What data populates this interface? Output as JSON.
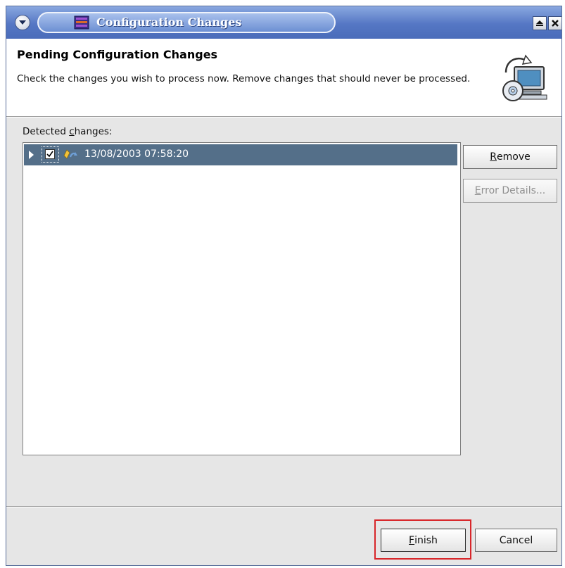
{
  "window": {
    "title": "Configuration Changes",
    "icons": {
      "menu": "chevron-down-icon",
      "app": "eclipse-app-icon",
      "maximize": "maximize-icon",
      "close": "close-icon"
    }
  },
  "header": {
    "title": "Pending Configuration Changes",
    "description": "Check the changes you wish to process now. Remove changes that should never be processed.",
    "icon": "configuration-wizard-icon"
  },
  "changes": {
    "label_prefix": "Detected ",
    "label_mnemonic": "c",
    "label_rest": "hanges:",
    "items": [
      {
        "timestamp": "13/08/2003 07:58:20",
        "checked": true,
        "selected": true,
        "icon": "configuration-change-icon"
      }
    ]
  },
  "buttons": {
    "remove": {
      "mnemonic": "R",
      "rest": "emove",
      "enabled": true
    },
    "error_details": {
      "mnemonic": "E",
      "rest": "rror Details...",
      "enabled": false
    },
    "finish": {
      "mnemonic": "F",
      "rest": "inish",
      "enabled": true
    },
    "cancel": {
      "label": "Cancel",
      "enabled": true
    }
  },
  "colors": {
    "titlebar": "#5577c4",
    "selection": "#546f89",
    "focus_highlight": "#d8262a"
  }
}
